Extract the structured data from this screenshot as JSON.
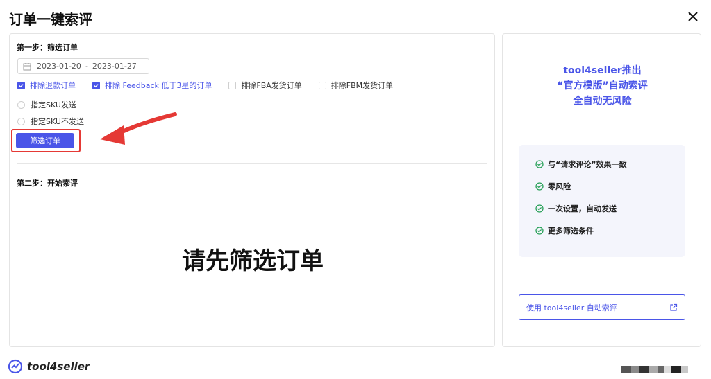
{
  "dialog": {
    "title": "订单一键索评"
  },
  "step1": {
    "label": "第一步：筛选订单",
    "date_start": "2023-01-20",
    "date_sep": "-",
    "date_end": "2023-01-27",
    "checkboxes": [
      {
        "label": "排除退款订单",
        "checked": true
      },
      {
        "label": "排除 Feedback 低于3星的订单",
        "checked": true
      },
      {
        "label": "排除FBA发货订单",
        "checked": false
      },
      {
        "label": "排除FBM发货订单",
        "checked": false
      }
    ],
    "radios": [
      {
        "label": "指定SKU发送"
      },
      {
        "label": "指定SKU不发送"
      }
    ],
    "filter_button": "筛选订单"
  },
  "step2": {
    "label": "第二步：开始索评",
    "empty_message": "请先筛选订单"
  },
  "promo": {
    "line1": "tool4seller推出",
    "line2": "“官方模版”自动索评",
    "line3": "全自动无风险",
    "features": [
      "与“请求评论”效果一致",
      "零风险",
      "一次设置，自动发送",
      "更多筛选条件"
    ],
    "use_button": "使用 tool4seller 自动索评"
  },
  "footer": {
    "brand": "tool4seller"
  },
  "colors": {
    "accent": "#4a55e8",
    "highlight": "#e53935",
    "check": "#2aa15a"
  },
  "icons": [
    "close-icon",
    "calendar-icon",
    "check-icon",
    "check-circle-icon",
    "external-link-icon",
    "brand-logo-icon",
    "arrow-icon"
  ]
}
